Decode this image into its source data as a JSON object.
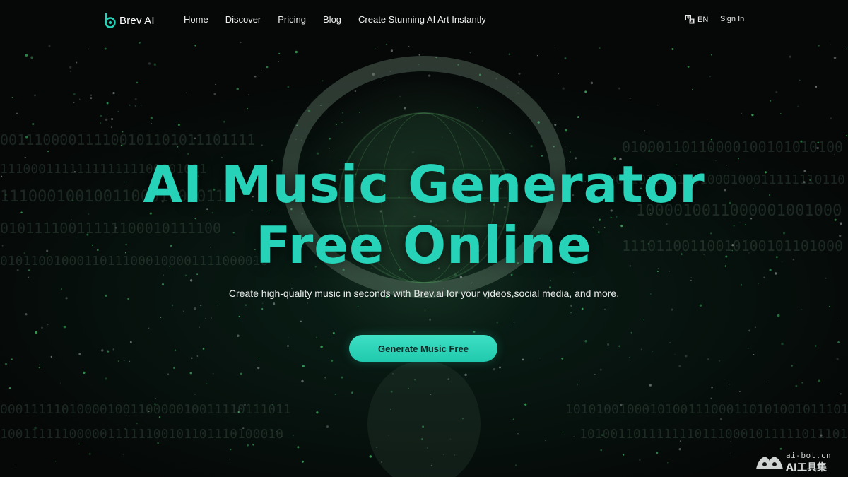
{
  "brand": {
    "name": "Brev AI",
    "accent_color": "#27d3b8",
    "logo_icon": "brev-logo-icon"
  },
  "nav": {
    "items": [
      {
        "label": "Home"
      },
      {
        "label": "Discover"
      },
      {
        "label": "Pricing"
      },
      {
        "label": "Blog"
      },
      {
        "label": "Create Stunning AI Art Instantly"
      }
    ],
    "language": {
      "label": "EN",
      "icon": "translate-icon"
    },
    "sign_in": "Sign In"
  },
  "hero": {
    "title_line1": "AI Music Generator",
    "title_line2": "Free Online",
    "subtitle": "Create high-quality music in seconds with Brev.ai for your videos,social media, and more.",
    "cta_label": "Generate Music Free"
  },
  "watermark": {
    "top": "ai-bot.cn",
    "bottom": "AI工具集",
    "icon": "watermark-logo-icon"
  }
}
